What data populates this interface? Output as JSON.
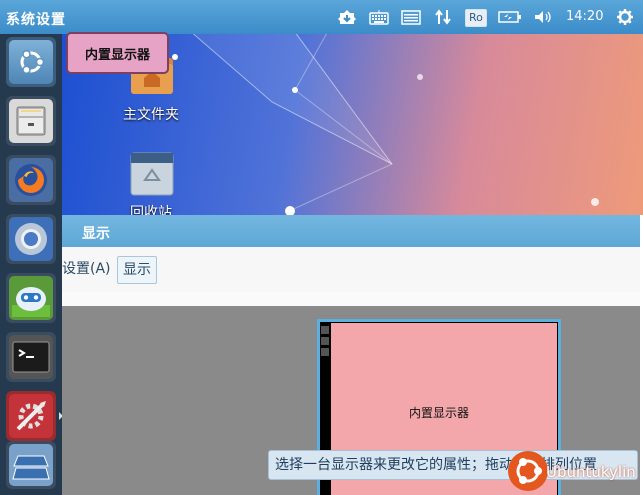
{
  "topbar": {
    "title": "系统设置",
    "indicators": [
      "settings-download-icon",
      "keyboard-icon",
      "keyboard-layout-icon",
      "network-transfer-icon",
      "battery-icon",
      "volume-icon",
      "gear-power-icon"
    ],
    "input_method": "Ro",
    "clock": "14:20"
  },
  "launcher": {
    "items": [
      {
        "name": "dash-home",
        "icon": "ubuntu-logo-icon"
      },
      {
        "name": "files",
        "icon": "file-cabinet-icon"
      },
      {
        "name": "firefox",
        "icon": "firefox-icon"
      },
      {
        "name": "chromium",
        "icon": "chromium-icon"
      },
      {
        "name": "kylin-assistant",
        "icon": "kylin-assistant-icon"
      },
      {
        "name": "terminal",
        "icon": "terminal-icon"
      },
      {
        "name": "system-settings",
        "icon": "settings-tools-icon",
        "active": true
      },
      {
        "name": "workspaces",
        "icon": "workspace-switcher-icon"
      }
    ]
  },
  "desktop": {
    "icons": [
      {
        "label": "主文件夹"
      },
      {
        "label": "回收站"
      }
    ]
  },
  "tooltip": {
    "text": "内置显示器"
  },
  "window": {
    "title": "显示",
    "breadcrumb": [
      "设置(A)",
      "显示"
    ],
    "monitor_label": "内置显示器",
    "hint": "选择一台显示器来更改它的属性；拖动它来排列位置"
  },
  "watermark": {
    "text": "Ubuntukylin"
  }
}
